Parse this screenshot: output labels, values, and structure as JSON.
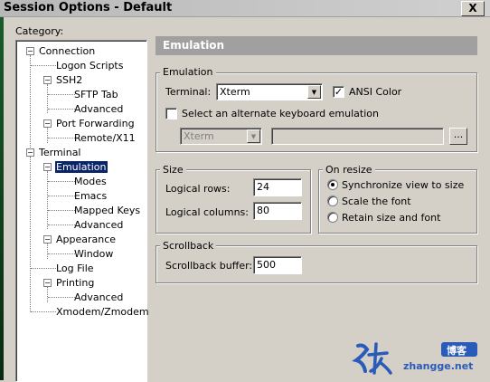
{
  "window": {
    "title": "Session Options - Default",
    "close_glyph": "X"
  },
  "category_label": "Category:",
  "tree": {
    "connection": "Connection",
    "logon_scripts": "Logon Scripts",
    "ssh2": "SSH2",
    "sftp_tab": "SFTP Tab",
    "ssh2_advanced": "Advanced",
    "port_forwarding": "Port Forwarding",
    "remote_x11": "Remote/X11",
    "terminal": "Terminal",
    "emulation": "Emulation",
    "modes": "Modes",
    "emacs": "Emacs",
    "mapped_keys": "Mapped Keys",
    "emulation_advanced": "Advanced",
    "appearance": "Appearance",
    "window": "Window",
    "log_file": "Log File",
    "printing": "Printing",
    "printing_advanced": "Advanced",
    "xmodem": "Xmodem/Zmodem"
  },
  "panel_header": "Emulation",
  "emulation_group": {
    "label": "Emulation",
    "terminal_label": "Terminal:",
    "terminal_value": "Xterm",
    "ansi_color_label": "ANSI Color",
    "ansi_color_checked": true,
    "alt_keyboard_label": "Select an alternate keyboard emulation",
    "alt_keyboard_checked": false,
    "alt_keyboard_value": "Xterm",
    "browse_label": "..."
  },
  "size_group": {
    "label": "Size",
    "rows_label": "Logical rows:",
    "rows_value": "24",
    "cols_label": "Logical columns:",
    "cols_value": "80"
  },
  "resize_group": {
    "label": "On resize",
    "options": [
      "Synchronize view to size",
      "Scale the font",
      "Retain size and font"
    ],
    "selected_index": 0
  },
  "scrollback_group": {
    "label": "Scrollback",
    "buffer_label": "Scrollback buffer:",
    "buffer_value": "500"
  },
  "watermark": {
    "text": "zhangge.net",
    "badge": "博客"
  }
}
